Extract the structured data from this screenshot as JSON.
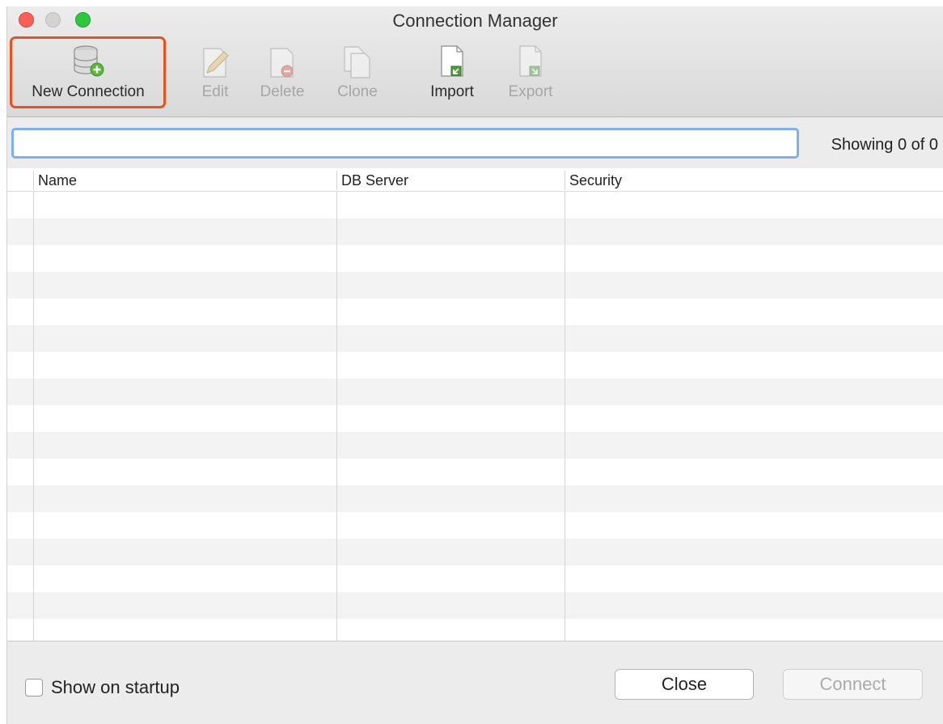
{
  "window": {
    "title": "Connection Manager"
  },
  "toolbar": {
    "new_connection": "New Connection",
    "edit": "Edit",
    "delete": "Delete",
    "clone": "Clone",
    "import": "Import",
    "export": "Export"
  },
  "search": {
    "value": "",
    "placeholder": ""
  },
  "status": {
    "showing": "Showing 0 of 0"
  },
  "table": {
    "columns": [
      "Name",
      "DB Server",
      "Security"
    ],
    "rows": []
  },
  "footer": {
    "show_on_startup": "Show on startup",
    "show_on_startup_checked": false,
    "close": "Close",
    "connect": "Connect"
  },
  "colors": {
    "highlight": "#e8531d",
    "search_focus": "#7fb0ee",
    "traffic_red": "#fc5f57",
    "traffic_green": "#2bc840"
  }
}
